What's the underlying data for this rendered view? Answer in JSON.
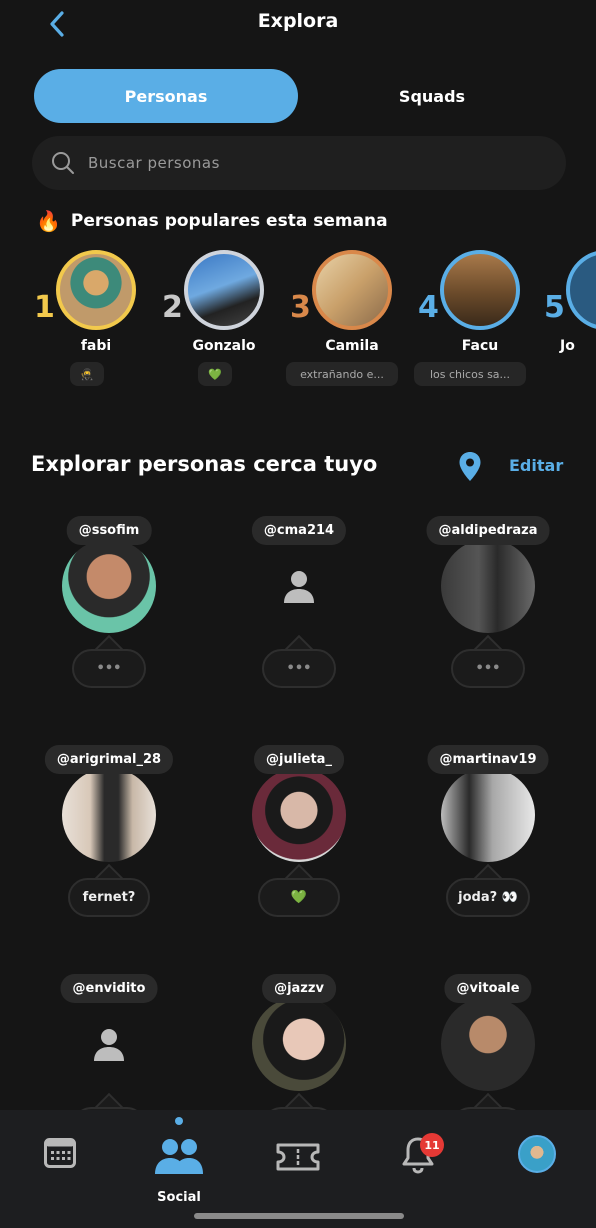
{
  "header": {
    "title": "Explora"
  },
  "segments": {
    "active": "Personas",
    "inactive": "Squads"
  },
  "search": {
    "placeholder": "Buscar personas"
  },
  "popular": {
    "title": "Personas populares esta semana",
    "people": [
      {
        "rank": "1",
        "name": "fabi",
        "status": "🥷",
        "rank_color": "#f2c94c",
        "ring": "#f2c94c"
      },
      {
        "rank": "2",
        "name": "Gonzalo",
        "status": "💚",
        "rank_color": "#c8c8c8",
        "ring": "#cfd4dc"
      },
      {
        "rank": "3",
        "name": "Camila",
        "status": "extrañando e...",
        "rank_color": "#d9884a",
        "ring": "#d9884a"
      },
      {
        "rank": "4",
        "name": "Facu",
        "status": "los chicos sa...",
        "rank_color": "#5aaee6",
        "ring": "#5aaee6"
      },
      {
        "rank": "5",
        "name": "Jo",
        "status": "",
        "rank_color": "#5aaee6",
        "ring": "#5aaee6"
      }
    ]
  },
  "nearby": {
    "title": "Explorar personas cerca tuyo",
    "edit_label": "Editar",
    "people": [
      {
        "handle": "@ssofim",
        "bubble": "•••",
        "has_photo": true
      },
      {
        "handle": "@cma214",
        "bubble": "•••",
        "has_photo": false
      },
      {
        "handle": "@aldipedraza",
        "bubble": "•••",
        "has_photo": true
      },
      {
        "handle": "@arigrimal_28",
        "bubble": "fernet?",
        "has_photo": true
      },
      {
        "handle": "@julieta_",
        "bubble": "💚",
        "has_photo": true
      },
      {
        "handle": "@martinav19",
        "bubble": "joda? 👀",
        "has_photo": true
      },
      {
        "handle": "@envidito",
        "bubble": "",
        "has_photo": false
      },
      {
        "handle": "@jazzv",
        "bubble": "",
        "has_photo": true
      },
      {
        "handle": "@vitoale",
        "bubble": "",
        "has_photo": true
      }
    ]
  },
  "tabbar": {
    "active_label": "Social",
    "notification_count": "11",
    "icons": [
      "calendar-icon",
      "people-icon",
      "ticket-icon",
      "bell-icon",
      "profile-avatar"
    ]
  },
  "colors": {
    "accent": "#5aaee6",
    "background": "#151515",
    "badge": "#e53935"
  }
}
